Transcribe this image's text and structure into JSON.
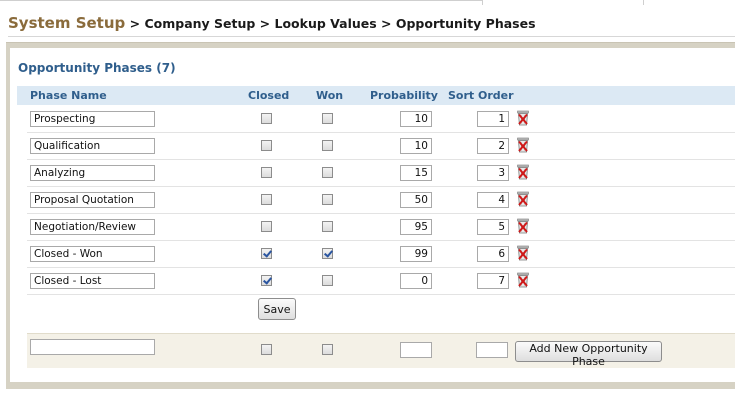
{
  "breadcrumb": {
    "root": "System Setup",
    "rest": " > Company Setup > Lookup Values > Opportunity Phases"
  },
  "panel": {
    "title": "Opportunity Phases (7)"
  },
  "columns": {
    "phase_name": "Phase Name",
    "closed": "Closed",
    "won": "Won",
    "probability": "Probability",
    "sort_order": "Sort Order"
  },
  "rows": [
    {
      "name": "Prospecting",
      "closed": false,
      "won": false,
      "probability": "10",
      "sort": "1"
    },
    {
      "name": "Qualification",
      "closed": false,
      "won": false,
      "probability": "10",
      "sort": "2"
    },
    {
      "name": "Analyzing",
      "closed": false,
      "won": false,
      "probability": "15",
      "sort": "3"
    },
    {
      "name": "Proposal Quotation",
      "closed": false,
      "won": false,
      "probability": "50",
      "sort": "4"
    },
    {
      "name": "Negotiation/Review",
      "closed": false,
      "won": false,
      "probability": "95",
      "sort": "5"
    },
    {
      "name": "Closed - Won",
      "closed": true,
      "won": true,
      "probability": "99",
      "sort": "6"
    },
    {
      "name": "Closed - Lost",
      "closed": true,
      "won": false,
      "probability": "0",
      "sort": "7"
    }
  ],
  "buttons": {
    "save": "Save",
    "add_new": "Add New Opportunity Phase"
  },
  "new_phase": {
    "name": "",
    "probability": "",
    "sort": ""
  },
  "icons": {
    "delete": "delete-icon"
  },
  "colors": {
    "breadcrumb_root": "#8a6b3b",
    "panel_title": "#2f5e8c",
    "header_bg": "#dce9f4",
    "delete_red": "#d01818"
  }
}
